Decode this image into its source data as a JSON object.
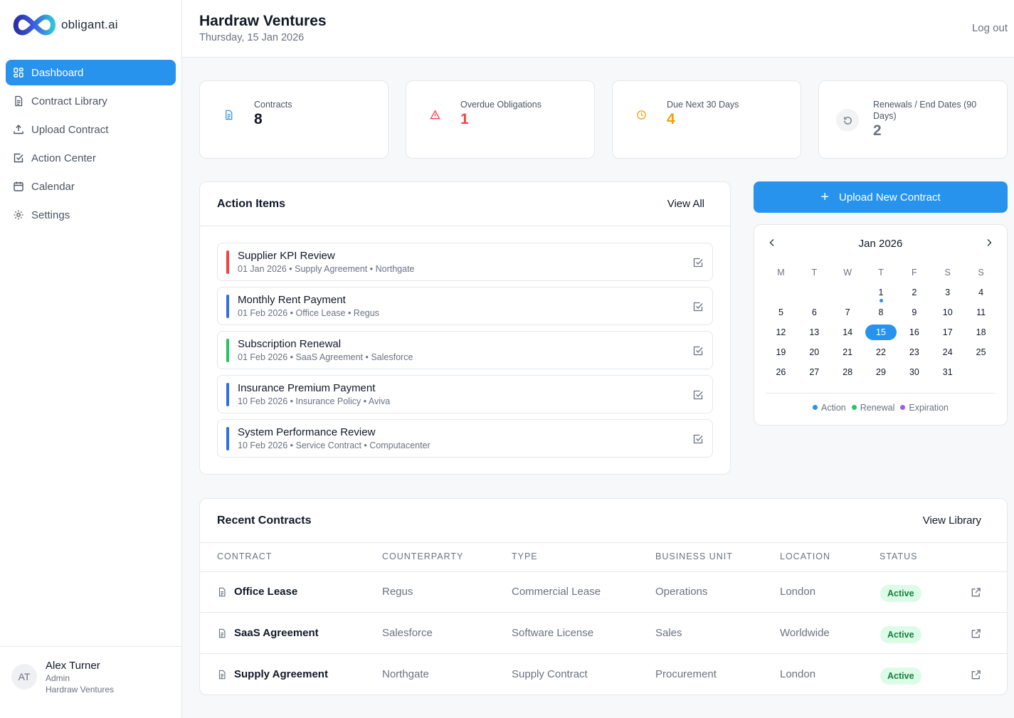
{
  "brand": {
    "name": "obligant.ai"
  },
  "sidebar": {
    "items": [
      {
        "label": "Dashboard",
        "icon": "grid-icon",
        "active": true
      },
      {
        "label": "Contract Library",
        "icon": "document-icon"
      },
      {
        "label": "Upload Contract",
        "icon": "upload-icon"
      },
      {
        "label": "Action Center",
        "icon": "check-square-icon"
      },
      {
        "label": "Calendar",
        "icon": "calendar-icon"
      },
      {
        "label": "Settings",
        "icon": "gear-icon"
      }
    ]
  },
  "user": {
    "initials": "AT",
    "name": "Alex Turner",
    "role": "Admin",
    "org": "Hardraw Ventures"
  },
  "header": {
    "title": "Hardraw Ventures",
    "date": "Thursday, 15 Jan 2026",
    "logout": "Log out"
  },
  "stats": [
    {
      "label": "Contracts",
      "value": "8",
      "icon": "document-icon",
      "color": "#2893ec"
    },
    {
      "label": "Overdue Obligations",
      "value": "1",
      "icon": "warning-icon",
      "color": "#ef4444"
    },
    {
      "label": "Due Next 30 Days",
      "value": "4",
      "icon": "clock-icon",
      "color": "#f59e0b"
    },
    {
      "label": "Renewals / End Dates (90 Days)",
      "value": "2",
      "icon": "refresh-icon",
      "color": "#6b7280"
    }
  ],
  "actions": {
    "title": "Action Items",
    "view_all": "View All",
    "items": [
      {
        "title": "Supplier KPI Review",
        "meta": "01 Jan 2026 • Supply Agreement • Northgate",
        "color": "#ef4444"
      },
      {
        "title": "Monthly Rent Payment",
        "meta": "01 Feb 2026 • Office Lease • Regus",
        "color": "#2f6fe0"
      },
      {
        "title": "Subscription Renewal",
        "meta": "01 Feb 2026 • SaaS Agreement • Salesforce",
        "color": "#22c55e"
      },
      {
        "title": "Insurance Premium Payment",
        "meta": "10 Feb 2026 • Insurance Policy • Aviva",
        "color": "#2f6fe0"
      },
      {
        "title": "System Performance Review",
        "meta": "10 Feb 2026 • Service Contract • Computacenter",
        "color": "#2f6fe0"
      }
    ]
  },
  "upload_button": {
    "label": "Upload New Contract"
  },
  "calendar": {
    "month": "Jan 2026",
    "weekdays": [
      "M",
      "T",
      "W",
      "T",
      "F",
      "S",
      "S"
    ],
    "weeks": [
      [
        "",
        "",
        "",
        "1",
        "2",
        "3",
        "4"
      ],
      [
        "5",
        "6",
        "7",
        "8",
        "9",
        "10",
        "11"
      ],
      [
        "12",
        "13",
        "14",
        "15",
        "16",
        "17",
        "18"
      ],
      [
        "19",
        "20",
        "21",
        "22",
        "23",
        "24",
        "25"
      ],
      [
        "26",
        "27",
        "28",
        "29",
        "30",
        "31",
        ""
      ]
    ],
    "today": "15",
    "marked_days": [
      {
        "day": "1",
        "type": "action"
      }
    ],
    "legend": [
      {
        "label": "Action",
        "color": "#2893ec"
      },
      {
        "label": "Renewal",
        "color": "#22c55e"
      },
      {
        "label": "Expiration",
        "color": "#a855f7"
      }
    ]
  },
  "recent": {
    "title": "Recent Contracts",
    "view_library": "View Library",
    "columns": [
      "CONTRACT",
      "COUNTERPARTY",
      "TYPE",
      "BUSINESS UNIT",
      "LOCATION",
      "STATUS"
    ],
    "rows": [
      {
        "contract": "Office Lease",
        "counterparty": "Regus",
        "type": "Commercial Lease",
        "unit": "Operations",
        "location": "London",
        "status": "Active"
      },
      {
        "contract": "SaaS Agreement",
        "counterparty": "Salesforce",
        "type": "Software License",
        "unit": "Sales",
        "location": "Worldwide",
        "status": "Active"
      },
      {
        "contract": "Supply Agreement",
        "counterparty": "Northgate",
        "type": "Supply Contract",
        "unit": "Procurement",
        "location": "London",
        "status": "Active"
      }
    ]
  }
}
